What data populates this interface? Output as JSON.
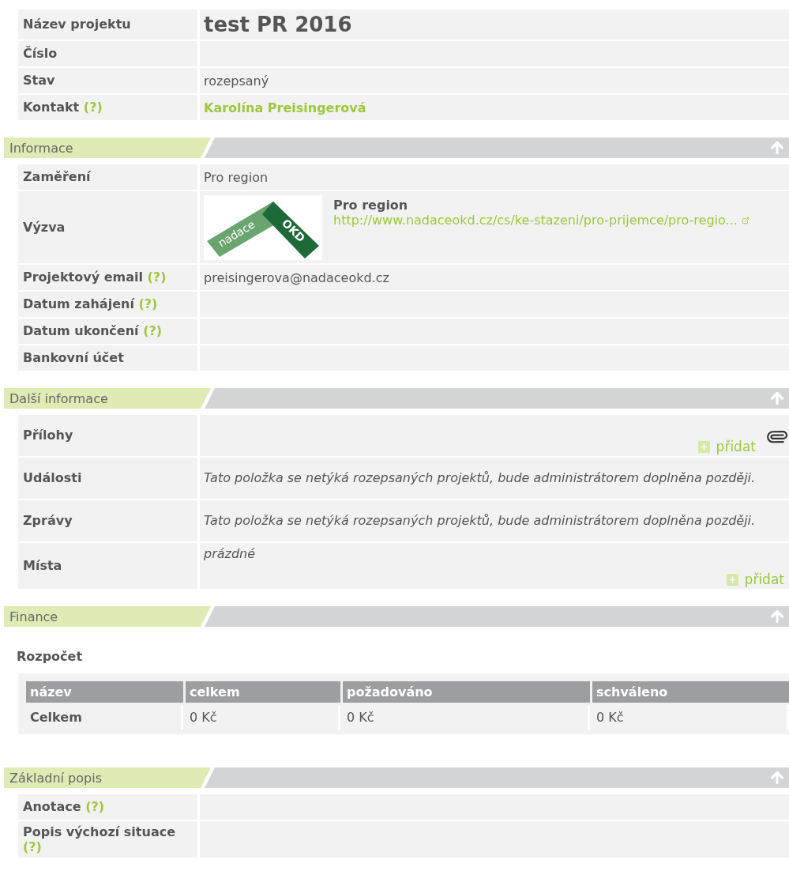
{
  "project": {
    "rows": [
      {
        "label": "Název projektu",
        "kind": "title",
        "value": "test PR 2016"
      },
      {
        "label": "Číslo",
        "kind": "text"
      },
      {
        "label": "Stav",
        "kind": "text",
        "value": "rozepsaný"
      },
      {
        "label": "Kontakt",
        "help": "(?)",
        "kind": "contact",
        "value": "Karolína Preisingerová"
      }
    ]
  },
  "sections": [
    {
      "title": "Informace",
      "kind": "rows",
      "rows": [
        {
          "label": "Zaměření",
          "kind": "text",
          "value": "Pro region"
        },
        {
          "label": "Výzva",
          "kind": "call",
          "logo_text": [
            "nadace",
            "OKD"
          ],
          "value": "Pro region",
          "link": "http://www.nadaceokd.cz/cs/ke-stazeni/pro-prijemce/pro-regio..."
        },
        {
          "label": "Projektový email",
          "help": "(?)",
          "kind": "text",
          "value": "preisingerova@nadaceokd.cz"
        },
        {
          "label": "Datum zahájení",
          "help": "(?)",
          "kind": "text"
        },
        {
          "label": "Datum ukončení",
          "help": "(?)",
          "kind": "text"
        },
        {
          "label": "Bankovní účet",
          "kind": "text"
        }
      ]
    },
    {
      "title": "Další informace",
      "kind": "rows",
      "rows": [
        {
          "label": "Přílohy",
          "kind": "attachments",
          "add": "přidat"
        },
        {
          "label": "Události",
          "kind": "note",
          "value": "Tato položka se netýká rozepsaných projektů, bude administrátorem doplněna později."
        },
        {
          "label": "Zprávy",
          "kind": "note",
          "value": "Tato položka se netýká rozepsaných projektů, bude administrátorem doplněna později."
        },
        {
          "label": "Místa",
          "kind": "places",
          "value": "prázdné",
          "add": "přidat"
        }
      ]
    },
    {
      "title": "Finance",
      "kind": "budget",
      "heading": "Rozpočet",
      "columns": [
        "název",
        "celkem",
        "požadováno",
        "schváleno"
      ],
      "rows": [
        [
          "Celkem",
          "0 Kč",
          "0 Kč",
          "0 Kč"
        ]
      ]
    },
    {
      "title": "Základní popis",
      "kind": "rows",
      "rows": [
        {
          "label": "Anotace",
          "help": "(?)",
          "kind": "text"
        },
        {
          "label": "Popis výchozí situace",
          "help": "(?)",
          "kind": "text"
        }
      ]
    }
  ]
}
